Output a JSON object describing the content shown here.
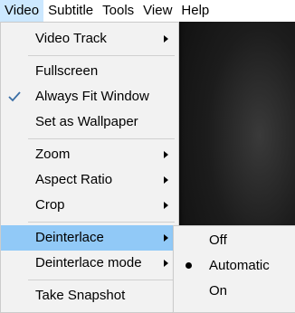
{
  "menubar": {
    "items": [
      {
        "label": "Video"
      },
      {
        "label": "Subtitle"
      },
      {
        "label": "Tools"
      },
      {
        "label": "View"
      },
      {
        "label": "Help"
      }
    ]
  },
  "video_menu": {
    "video_track": "Video Track",
    "fullscreen": "Fullscreen",
    "always_fit_window": "Always Fit Window",
    "set_as_wallpaper": "Set as Wallpaper",
    "zoom": "Zoom",
    "aspect_ratio": "Aspect Ratio",
    "crop": "Crop",
    "deinterlace": "Deinterlace",
    "deinterlace_mode": "Deinterlace mode",
    "take_snapshot": "Take Snapshot"
  },
  "deinterlace_menu": {
    "off": "Off",
    "automatic": "Automatic",
    "on": "On",
    "selected": "Automatic"
  },
  "colors": {
    "highlight": "#91c9f7",
    "menu_background": "#f2f2f2",
    "active_menubar": "#cce8ff"
  }
}
